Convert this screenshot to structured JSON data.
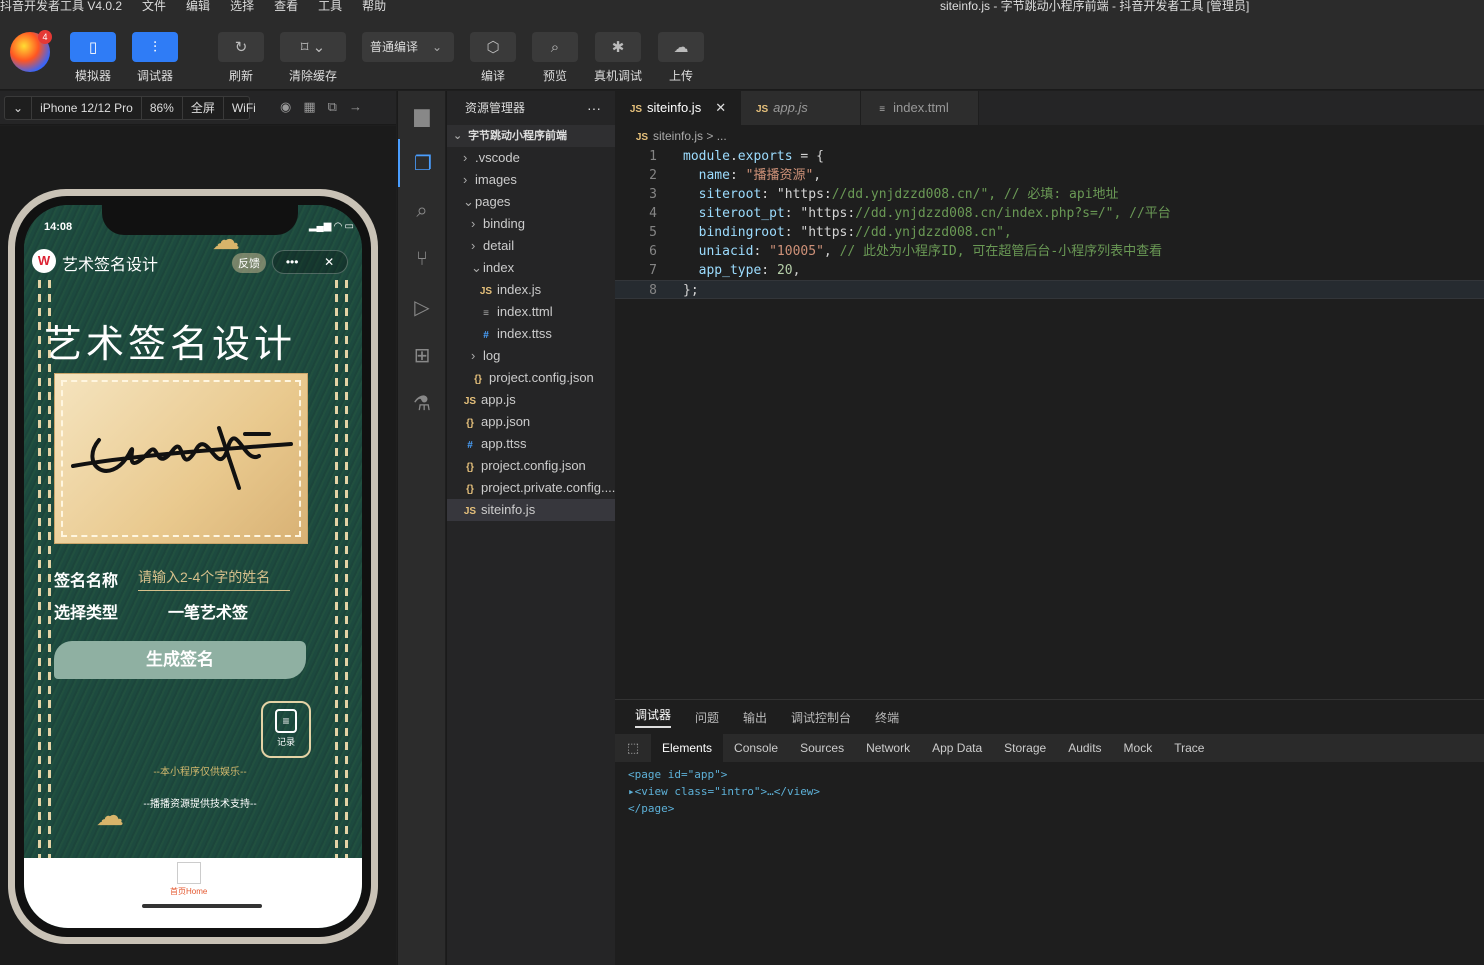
{
  "app": {
    "menu": [
      "抖音开发者工具 V4.0.2",
      "文件",
      "编辑",
      "选择",
      "查看",
      "工具",
      "帮助"
    ],
    "window_title": "siteinfo.js - 字节跳动小程序前端 - 抖音开发者工具 [管理员]",
    "badge_count": "4"
  },
  "toolbar": {
    "simulator": "模拟器",
    "debugger": "调试器",
    "refresh": "刷新",
    "clear_cache": "清除缓存",
    "compile_mode": "普通编译",
    "compile": "编译",
    "preview": "预览",
    "device_debug": "真机调试",
    "upload": "上传"
  },
  "simbar": {
    "device": "iPhone 12/12 Pro",
    "zoom": "86%",
    "fullscreen": "全屏",
    "network": "WiFi"
  },
  "phone": {
    "time": "14:08",
    "app_title": "艺术签名设计",
    "feedback": "反馈",
    "big_title": "艺术签名设计",
    "name_label": "签名名称",
    "name_placeholder": "请输入2-4个字的姓名",
    "type_label": "选择类型",
    "type_value": "一笔艺术签",
    "generate": "生成签名",
    "records": "记录",
    "footer1": "--本小程序仅供娱乐--",
    "footer2": "--播播资源提供技术支持--",
    "tab_home": "首页Home"
  },
  "explorer": {
    "title": "资源管理器",
    "root": "字节跳动小程序前端",
    "items": [
      {
        "label": ".vscode",
        "type": "folder",
        "depth": 1,
        "open": false
      },
      {
        "label": "images",
        "type": "folder",
        "depth": 1,
        "open": false
      },
      {
        "label": "pages",
        "type": "folder",
        "depth": 1,
        "open": true
      },
      {
        "label": "binding",
        "type": "folder",
        "depth": 2,
        "open": false
      },
      {
        "label": "detail",
        "type": "folder",
        "depth": 2,
        "open": false
      },
      {
        "label": "index",
        "type": "folder",
        "depth": 2,
        "open": true
      },
      {
        "label": "index.js",
        "type": "js",
        "depth": 3
      },
      {
        "label": "index.ttml",
        "type": "ttml",
        "depth": 3
      },
      {
        "label": "index.ttss",
        "type": "css",
        "depth": 3
      },
      {
        "label": "log",
        "type": "folder",
        "depth": 2,
        "open": false
      },
      {
        "label": "project.config.json",
        "type": "json",
        "depth": 2
      },
      {
        "label": "app.js",
        "type": "js",
        "depth": 1
      },
      {
        "label": "app.json",
        "type": "json",
        "depth": 1
      },
      {
        "label": "app.ttss",
        "type": "css",
        "depth": 1
      },
      {
        "label": "project.config.json",
        "type": "json",
        "depth": 1
      },
      {
        "label": "project.private.config....",
        "type": "json",
        "depth": 1
      },
      {
        "label": "siteinfo.js",
        "type": "js",
        "depth": 1,
        "selected": true
      }
    ]
  },
  "editor": {
    "tabs": [
      {
        "label": "siteinfo.js",
        "icon": "JS",
        "active": true
      },
      {
        "label": "app.js",
        "icon": "JS",
        "active": false
      },
      {
        "label": "index.ttml",
        "icon": "≡",
        "active": false
      }
    ],
    "breadcrumb": "siteinfo.js > ...",
    "lines": [
      "module.exports = {",
      "  name: \"播播资源\",",
      "  siteroot: \"https://dd.ynjdzzd008.cn/\", // 必填: api地址",
      "  siteroot_pt: \"https://dd.ynjdzzd008.cn/index.php?s=/\", //平台",
      "  bindingroot: \"https://dd.ynjdzzd008.cn\",",
      "  uniacid: \"10005\", // 此处为小程序ID, 可在超管后台-小程序列表中查看",
      "  app_type: 20,",
      "};"
    ]
  },
  "debug": {
    "tabs": [
      "调试器",
      "问题",
      "输出",
      "调试控制台",
      "终端"
    ],
    "devtools_tabs": [
      "Elements",
      "Console",
      "Sources",
      "Network",
      "App Data",
      "Storage",
      "Audits",
      "Mock",
      "Trace"
    ],
    "dom": [
      "<page id=\"app\">",
      "<view class=\"intro\">…</view>",
      "</page>"
    ]
  }
}
